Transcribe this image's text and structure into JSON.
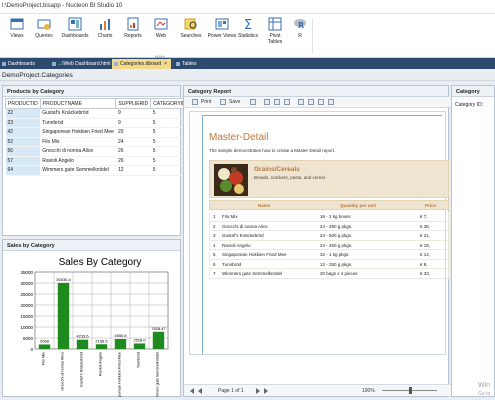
{
  "titlebar": {
    "text": "l:\\DemoProject.bisapp - Nucleon BI Studio 10"
  },
  "ribbon": {
    "buttons": [
      {
        "label": "Views"
      },
      {
        "label": "Queries"
      },
      {
        "label": "Dashboards"
      },
      {
        "label": "Charts"
      },
      {
        "label": "Reports"
      },
      {
        "label": "Web"
      },
      {
        "label": "Searches"
      },
      {
        "label": "Power Views"
      },
      {
        "label": "Statistics"
      },
      {
        "label": "Pivot Tables"
      },
      {
        "label": "R"
      }
    ],
    "group_label": "MAIN"
  },
  "tabs": [
    {
      "label": "Dashboards"
    },
    {
      "label": "...\\Web Dashboard.html"
    },
    {
      "label": "Categories.dboard"
    },
    {
      "label": "Tables"
    }
  ],
  "breadcrumb": "DemoProject.Categories",
  "products_panel": {
    "title": "Products by Category",
    "columns": [
      "PRODUCTID",
      "PRODUCTNAME",
      "SUPPLIERID",
      "CATEGORYID"
    ],
    "rows": [
      [
        "22",
        "Gustaf's Knäckebröd",
        "9",
        "5"
      ],
      [
        "23",
        "Tunnbröd",
        "9",
        "5"
      ],
      [
        "42",
        "Singaporean Hokkien Fried Mee",
        "20",
        "5"
      ],
      [
        "52",
        "Filo Mix",
        "24",
        "5"
      ],
      [
        "56",
        "Gnocchi di nonna Alice",
        "26",
        "5"
      ],
      [
        "57",
        "Ravioli Angelo",
        "26",
        "5"
      ],
      [
        "64",
        "Wimmers gute Semmelknödel",
        "12",
        "5"
      ]
    ]
  },
  "sales_panel": {
    "title": "Sales by Category"
  },
  "chart_data": {
    "type": "bar",
    "title": "Sales By Category",
    "categories": [
      "Filo Mix",
      "Gnocchi di nonna Alice",
      "Gustaf's Knäckebröd",
      "Ravioli Angelo",
      "Singaporean Hokkien Fried Mee",
      "Tunnbröd",
      "Wimmers gute Semmelknödel"
    ],
    "values": [
      2068,
      30030.4,
      4233.6,
      2156.5,
      4550.6,
      2528.0,
      7828.47
    ],
    "data_labels": [
      "2068",
      "30030.4",
      "4233.6",
      "2156.5",
      "4550.6",
      "2528.0",
      "7828.47"
    ],
    "yticks": [
      "0",
      "5000",
      "10000",
      "15000",
      "20000",
      "25000",
      "30000",
      "35000"
    ],
    "ylim": [
      0,
      35000
    ],
    "grid": true,
    "bar_color": "#1f8a1f"
  },
  "report_panel": {
    "title": "Category Report",
    "toolbar": {
      "print": "Print",
      "save": "Save"
    },
    "report_title": "Master-Detail",
    "report_subtitle": "The sample demonstrates how to create a Master-Detail report.",
    "category_name": "Grains/Cereals",
    "category_desc": "Breads, crackers, pasta, and cereal",
    "col_name": "Name",
    "col_qty": "Quantity per unit",
    "col_price": "Price",
    "rows": [
      [
        "1",
        "Filo Mix",
        "16 - 2 kg boxes",
        "€ 7,"
      ],
      [
        "2",
        "Gnocchi di nonna Alice",
        "24 - 250 g pkgs.",
        "€ 38,"
      ],
      [
        "3",
        "Gustaf's Knäckebröd",
        "24 - 500 g pkgs.",
        "€ 21,"
      ],
      [
        "4",
        "Ravioli Angelo",
        "24 - 250 g pkgs.",
        "€ 19,"
      ],
      [
        "5",
        "Singaporean Hokkien Fried Mee",
        "32 - 1 kg pkgs.",
        "€ 14,"
      ],
      [
        "6",
        "Tunnbröd",
        "12 - 250 g pkgs.",
        "€ 9,"
      ],
      [
        "7",
        "Wimmers gute Semmelknödel",
        "20 bags x 4 pieces",
        "€ 33,"
      ]
    ],
    "status": {
      "page": "Page 1 of 1",
      "zoom": "100%"
    }
  },
  "category_panel": {
    "title": "Category",
    "field_label": "Category ID:"
  },
  "watermark": {
    "line1": "Win",
    "line2": "Go to"
  }
}
